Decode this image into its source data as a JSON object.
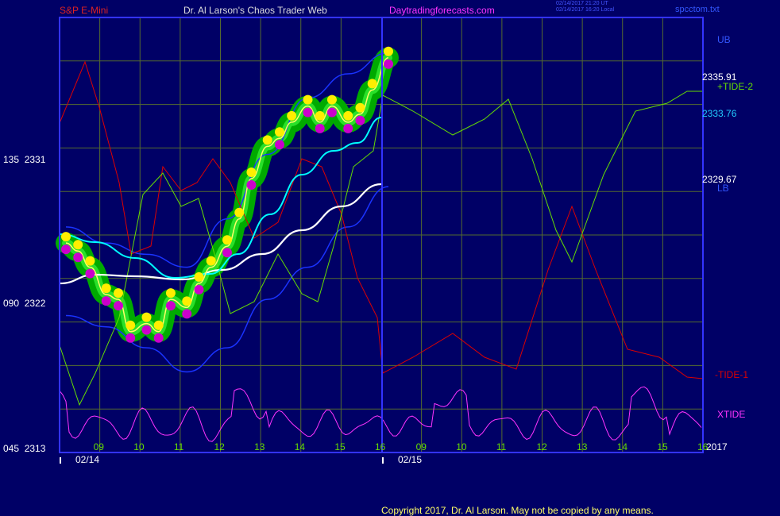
{
  "header": {
    "symbol": "S&P E-Mini",
    "brand": "Dr. Al Larson's Chaos Trader Web",
    "site": "Daytradingforecasts.com",
    "stamp_line1": "02/14/2017 21:20 UT",
    "stamp_line2": "02/14/2017 16:20 Local",
    "file": "spcctom.txt"
  },
  "y_axis_left": {
    "ticks": [
      {
        "code": "135",
        "price": "2331"
      },
      {
        "code": "090",
        "price": "2322"
      },
      {
        "code": "045",
        "price": "2313"
      }
    ]
  },
  "right_labels": {
    "ub": "UB",
    "price_high": "2335.91",
    "tide2": "+TIDE-2",
    "price_mid": "2333.76",
    "price_low": "2329.67",
    "lb": "LB",
    "tide1": "-TIDE-1",
    "xtide": "XTIDE",
    "year": "2017"
  },
  "x_axis": {
    "hours_day1": [
      "09",
      "10",
      "11",
      "12",
      "13",
      "14",
      "15",
      "16"
    ],
    "hours_day2": [
      "09",
      "10",
      "11",
      "12",
      "13",
      "14",
      "15",
      "16"
    ],
    "dates": [
      "02/14",
      "02/15"
    ]
  },
  "footer": {
    "copyright": "Copyright 2017, Dr. Al Larson. May not be copied by any means."
  },
  "colors": {
    "background": "#000066",
    "frame": "#3333ff",
    "grid": "#556b2f",
    "price_band": "#00aa00",
    "highs": "#ffee00",
    "lows": "#cc00cc",
    "tide1": "#dd0000",
    "tide2": "#66dd00",
    "xtide": "#ff33ff",
    "ma_fast": "#00ffff",
    "ma_slow": "#ffffff",
    "bands": "#1a33ff",
    "price_line": "#ffff66"
  },
  "chart_data": {
    "type": "line",
    "title": "S&P E-Mini",
    "y_range": [
      2313,
      2340
    ],
    "x_axis_hours": [
      "09",
      "10",
      "11",
      "12",
      "13",
      "14",
      "15",
      "16"
    ],
    "days": [
      "02/14",
      "02/15"
    ],
    "series": [
      {
        "name": "S&P E-Mini",
        "x_hours": [
          8.0,
          8.3,
          8.6,
          9.0,
          9.3,
          9.6,
          10.0,
          10.3,
          10.6,
          11.0,
          11.3,
          11.6,
          12.0,
          12.3,
          12.6,
          13.0,
          13.3,
          13.6,
          14.0,
          14.3,
          14.6,
          15.0,
          15.3,
          15.6,
          16.0
        ],
        "values": [
          2326.0,
          2325.5,
          2324.5,
          2322.8,
          2322.5,
          2320.5,
          2321.0,
          2320.5,
          2322.5,
          2322.0,
          2323.5,
          2324.5,
          2325.8,
          2327.5,
          2330.0,
          2332.0,
          2332.5,
          2333.5,
          2334.5,
          2333.5,
          2334.5,
          2333.5,
          2334.0,
          2335.5,
          2337.5
        ]
      },
      {
        "name": "UB",
        "x_hours": [
          8.0,
          9.0,
          10.0,
          11.0,
          12.0,
          13.0,
          14.0,
          15.0,
          16.0
        ],
        "values": [
          2327.0,
          2326.0,
          2325.3,
          2324.5,
          2327.5,
          2331.5,
          2335.0,
          2336.5,
          2337.8
        ]
      },
      {
        "name": "LB",
        "x_hours": [
          8.0,
          9.0,
          10.0,
          11.0,
          12.0,
          13.0,
          14.0,
          15.0,
          16.0
        ],
        "values": [
          2321.5,
          2320.8,
          2319.5,
          2318.0,
          2319.5,
          2322.5,
          2324.5,
          2327.0,
          2329.5
        ]
      }
    ],
    "annotations": {
      "last_price_label": "2335.91",
      "ub_label": "2333.76",
      "lb_label": "2329.67"
    }
  }
}
